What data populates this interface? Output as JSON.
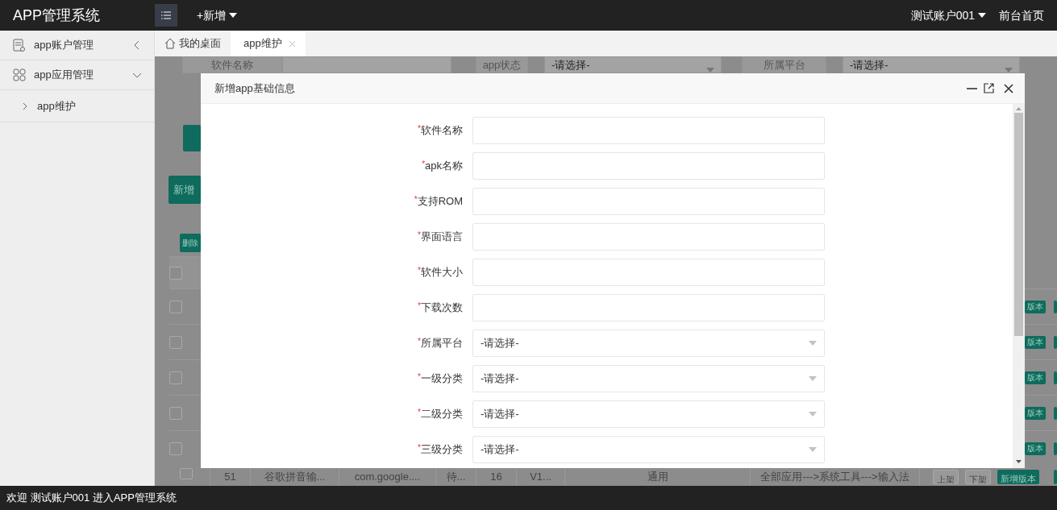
{
  "navbar": {
    "brand": "APP管理系统",
    "new_menu": "+新增",
    "account": "测试账户001",
    "home_link": "前台首页"
  },
  "sidebar": {
    "items": [
      {
        "label": "app账户管理",
        "kind": "account",
        "expanded": false
      },
      {
        "label": "app应用管理",
        "kind": "apps",
        "expanded": true,
        "children": [
          {
            "label": "app维护"
          }
        ]
      }
    ]
  },
  "tabs": [
    {
      "label": "我的桌面",
      "kind": "home",
      "selected": false
    },
    {
      "label": "app维护",
      "kind": "page",
      "selected": true
    }
  ],
  "background": {
    "filters": [
      {
        "label": "软件名称",
        "kind": "text"
      },
      {
        "label": "app状态",
        "kind": "select",
        "value": "-请选择-"
      },
      {
        "label": "所属平台",
        "kind": "select",
        "value": "-请选择-"
      }
    ],
    "add_button": "新增",
    "delete_button": "删除",
    "header_checked": false,
    "rows": [
      {
        "checked": false,
        "action": "版本"
      },
      {
        "checked": false,
        "action": "版本"
      },
      {
        "checked": false,
        "action": "版本"
      },
      {
        "checked": false,
        "action": "版本"
      },
      {
        "checked": false,
        "action": "版本"
      }
    ],
    "last_row": {
      "checked": false,
      "cells": [
        "51",
        "谷歌拼音输...",
        "com.google....",
        "待...",
        "16",
        "V1...",
        "通用",
        "全部应用--->系统工具--->输入法"
      ],
      "actions": [
        "上架",
        "下架",
        "新增版本"
      ]
    }
  },
  "modal": {
    "title": "新增app基础信息",
    "fields": [
      {
        "label": "软件名称",
        "kind": "text",
        "required_mark": "*"
      },
      {
        "label": "apk名称",
        "kind": "text",
        "required_mark": "*"
      },
      {
        "label": "支持ROM",
        "kind": "text",
        "required_mark": "*"
      },
      {
        "label": "界面语言",
        "kind": "text",
        "required_mark": "*"
      },
      {
        "label": "软件大小",
        "kind": "text",
        "required_mark": "*"
      },
      {
        "label": "下载次数",
        "kind": "text",
        "required_mark": "*"
      },
      {
        "label": "所属平台",
        "kind": "select",
        "required_mark": "*",
        "value": "-请选择-"
      },
      {
        "label": "一级分类",
        "kind": "select",
        "required_mark": "*",
        "value": "-请选择-"
      },
      {
        "label": "二级分类",
        "kind": "select",
        "required_mark": "*",
        "value": "-请选择-"
      },
      {
        "label": "三级分类",
        "kind": "select",
        "required_mark": "*",
        "value": "-请选择-"
      }
    ]
  },
  "status_bar": "欢迎 测试账户001 进入APP管理系统"
}
